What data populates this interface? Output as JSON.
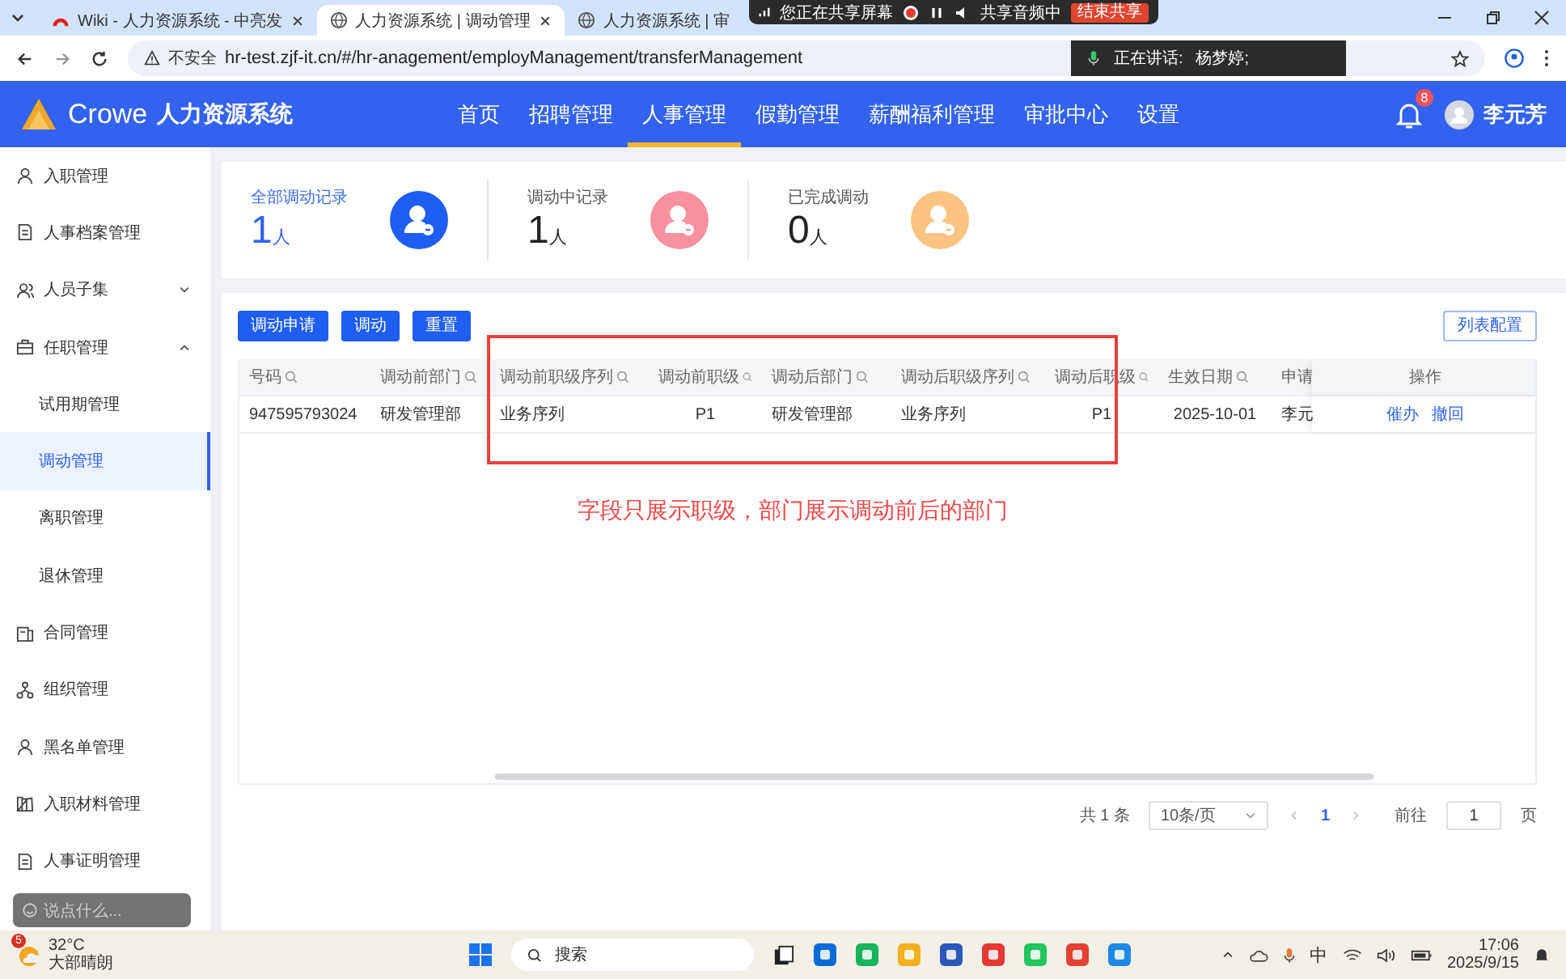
{
  "browser": {
    "tabs": [
      {
        "title": "Wiki - 人力资源系统 - 中亮发",
        "selected": false
      },
      {
        "title": "人力资源系统 | 调动管理",
        "selected": true
      },
      {
        "title": "人力资源系统 | 审",
        "selected": false
      }
    ],
    "security": "不安全",
    "url": "hr-test.zjf-it.cn/#/hr-anagement/employManagement/transferManagement"
  },
  "share_bar": {
    "status": "您正在共享屏幕",
    "audio": "共享音频中",
    "stop": "结束共享"
  },
  "speaking": {
    "label": "正在讲话:",
    "name": "杨梦婷;"
  },
  "header": {
    "logo": "Crowe",
    "system": "人力资源系统",
    "notifications": "8",
    "user": "李元芳",
    "nav": [
      {
        "label": "首页",
        "selected": false
      },
      {
        "label": "招聘管理",
        "selected": false
      },
      {
        "label": "人事管理",
        "selected": true
      },
      {
        "label": "假勤管理",
        "selected": false
      },
      {
        "label": "薪酬福利管理",
        "selected": false
      },
      {
        "label": "审批中心",
        "selected": false
      },
      {
        "label": "设置",
        "selected": false
      }
    ]
  },
  "sidebar": {
    "items": [
      {
        "label": "入职管理",
        "selected": false
      },
      {
        "label": "人事档案管理",
        "selected": false
      },
      {
        "label": "人员子集",
        "selected": false,
        "expanded": false
      },
      {
        "label": "任职管理",
        "selected": false,
        "expanded": true,
        "children": [
          {
            "label": "试用期管理",
            "selected": false
          },
          {
            "label": "调动管理",
            "selected": true
          },
          {
            "label": "离职管理",
            "selected": false
          },
          {
            "label": "退休管理",
            "selected": false
          }
        ]
      },
      {
        "label": "合同管理",
        "selected": false
      },
      {
        "label": "组织管理",
        "selected": false
      },
      {
        "label": "黑名单管理",
        "selected": false
      },
      {
        "label": "入职材料管理",
        "selected": false
      },
      {
        "label": "人事证明管理",
        "selected": false
      }
    ]
  },
  "stats": [
    {
      "label": "全部调动记录",
      "count": "1",
      "unit": "人",
      "selected": true,
      "color": "#1f5ef2"
    },
    {
      "label": "调动中记录",
      "count": "1",
      "unit": "人",
      "selected": false,
      "color": "#f7909f"
    },
    {
      "label": "已完成调动",
      "count": "0",
      "unit": "人",
      "selected": false,
      "color": "#fcc482"
    }
  ],
  "toolbar": {
    "buttons": [
      "调动申请",
      "调动",
      "重置"
    ],
    "config": "列表配置"
  },
  "table": {
    "columns": [
      {
        "label": "号码",
        "searchable": true
      },
      {
        "label": "调动前部门",
        "searchable": true
      },
      {
        "label": "调动前职级序列",
        "searchable": true
      },
      {
        "label": "调动前职级",
        "searchable": true
      },
      {
        "label": "调动后部门",
        "searchable": true
      },
      {
        "label": "调动后职级序列",
        "searchable": true
      },
      {
        "label": "调动后职级",
        "searchable": true
      },
      {
        "label": "生效日期",
        "searchable": true
      },
      {
        "label": "申请"
      },
      {
        "label": "操作",
        "searchable": false
      }
    ],
    "rows": [
      {
        "cells": [
          "947595793024",
          "研发管理部",
          "业务序列",
          "P1",
          "研发管理部",
          "业务序列",
          "P1",
          "2025-10-01",
          "李元"
        ],
        "actions": [
          "催办",
          "撤回"
        ]
      }
    ]
  },
  "annotation": {
    "note": "字段只展示职级，部门展示调动前后的部门"
  },
  "pagination": {
    "total": "共 1 条",
    "page_size": "10条/页",
    "pages": [
      {
        "label": "1",
        "selected": true
      }
    ],
    "goto_label": "前往",
    "goto_value": "1",
    "goto_suffix": "页"
  },
  "chat_input": {
    "placeholder": "说点什么..."
  },
  "taskbar": {
    "badge": "5",
    "temp": "32°C",
    "weather": "大部晴朗",
    "search": "搜索",
    "ime": "中",
    "time": "17:06",
    "date": "2025/9/15"
  }
}
